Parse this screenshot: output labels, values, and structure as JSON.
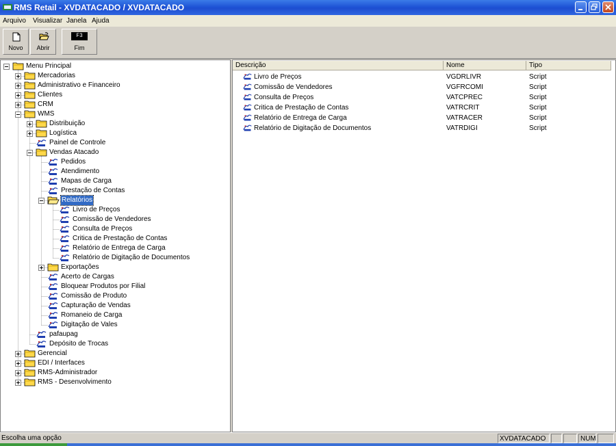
{
  "window": {
    "title": "RMS Retail - XVDATACADO / XVDATACADO"
  },
  "menu": [
    "Arquivo",
    "Visualizar",
    "Janela",
    "Ajuda"
  ],
  "toolbar": {
    "novo": "Novo",
    "abrir": "Abrir",
    "fim": "Fim",
    "fim_key": "F3"
  },
  "tree": [
    {
      "label": "Menu Principal",
      "type": "folder",
      "toggle": "minus"
    },
    {
      "label": "Mercadorias",
      "type": "folder",
      "toggle": "plus"
    },
    {
      "label": "Administrativo e Financeiro",
      "type": "folder",
      "toggle": "plus"
    },
    {
      "label": "Clientes",
      "type": "folder",
      "toggle": "plus"
    },
    {
      "label": "CRM",
      "type": "folder",
      "toggle": "plus"
    },
    {
      "label": "WMS",
      "type": "folder",
      "toggle": "minus"
    },
    {
      "label": "Distribuição",
      "type": "folder",
      "toggle": "plus"
    },
    {
      "label": "Logística",
      "type": "folder",
      "toggle": "plus"
    },
    {
      "label": "Painel de Controle",
      "type": "script",
      "toggle": ""
    },
    {
      "label": "Vendas Atacado",
      "type": "folder",
      "toggle": "minus"
    },
    {
      "label": "Pedidos",
      "type": "script",
      "toggle": ""
    },
    {
      "label": "Atendimento",
      "type": "script",
      "toggle": ""
    },
    {
      "label": "Mapas de Carga",
      "type": "script",
      "toggle": ""
    },
    {
      "label": "Prestação de Contas",
      "type": "script",
      "toggle": ""
    },
    {
      "label": "Relatórios",
      "type": "folder-open",
      "toggle": "minus",
      "selected": true
    },
    {
      "label": "Livro de Preços",
      "type": "script",
      "toggle": ""
    },
    {
      "label": "Comissão de Vendedores",
      "type": "script",
      "toggle": ""
    },
    {
      "label": "Consulta de Preços",
      "type": "script",
      "toggle": ""
    },
    {
      "label": "Critica de Prestação de Contas",
      "type": "script",
      "toggle": ""
    },
    {
      "label": "Relatório de Entrega de Carga",
      "type": "script",
      "toggle": ""
    },
    {
      "label": "Relatório de Digitação de Documentos",
      "type": "script",
      "toggle": ""
    },
    {
      "label": "Exportações",
      "type": "folder",
      "toggle": "plus"
    },
    {
      "label": "Acerto de Cargas",
      "type": "script",
      "toggle": ""
    },
    {
      "label": "Bloquear Produtos por Filial",
      "type": "script",
      "toggle": ""
    },
    {
      "label": "Comissão de Produto",
      "type": "script",
      "toggle": ""
    },
    {
      "label": "Capturação de Vendas",
      "type": "script",
      "toggle": ""
    },
    {
      "label": "Romaneio de Carga",
      "type": "script",
      "toggle": ""
    },
    {
      "label": "Digitação de Vales",
      "type": "script",
      "toggle": ""
    },
    {
      "label": "pafaupag",
      "type": "script",
      "toggle": ""
    },
    {
      "label": "Depósito de Trocas",
      "type": "script",
      "toggle": ""
    },
    {
      "label": "Gerencial",
      "type": "folder",
      "toggle": "plus"
    },
    {
      "label": "EDI / Interfaces",
      "type": "folder",
      "toggle": "plus"
    },
    {
      "label": "RMS-Administrador",
      "type": "folder",
      "toggle": "plus"
    },
    {
      "label": "RMS - Desenvolvimento",
      "type": "folder",
      "toggle": "plus"
    }
  ],
  "list": {
    "columns": [
      "Descrição",
      "Nome",
      "Tipo"
    ],
    "rows": [
      [
        "Livro de Preços",
        "VGDRLIVR",
        "Script"
      ],
      [
        "Comissão de Vendedores",
        "VGFRCOMI",
        "Script"
      ],
      [
        "Consulta de Preços",
        "VATCPREC",
        "Script"
      ],
      [
        "Critica de Prestação de Contas",
        "VATRCRIT",
        "Script"
      ],
      [
        "Relatório de Entrega de Carga",
        "VATRACER",
        "Script"
      ],
      [
        "Relatório de Digitação de Documentos",
        "VATRDIGI",
        "Script"
      ]
    ]
  },
  "status": {
    "message": "Escolha uma opção",
    "user": "XVDATACADO",
    "num": "NUM"
  },
  "colors": {
    "titlebar": "#1f54d6",
    "folder": "#ffd84a",
    "selection": "#316ac5"
  }
}
